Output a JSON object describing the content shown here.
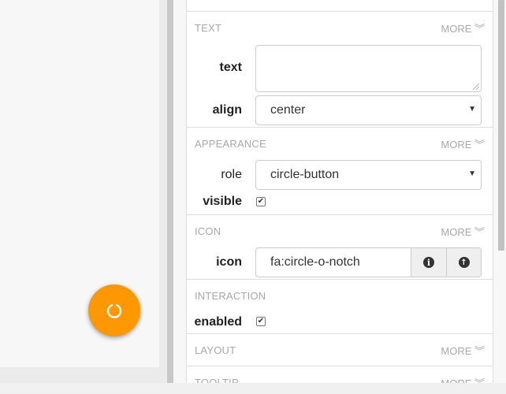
{
  "sections": {
    "text": {
      "title": "TEXT",
      "more": "MORE ︾",
      "text_label": "text",
      "text_value": "",
      "align_label": "align",
      "align_value": "center"
    },
    "appearance": {
      "title": "APPEARANCE",
      "more": "MORE ︾",
      "role_label": "role",
      "role_value": "circle-button",
      "visible_label": "visible",
      "visible_checked": true
    },
    "icon": {
      "title": "ICON",
      "more": "MORE ︾",
      "icon_label": "icon",
      "icon_value": "fa:circle-o-notch",
      "info_glyph": "i",
      "upload_glyph": "↑"
    },
    "interaction": {
      "title": "INTERACTION",
      "enabled_label": "enabled",
      "enabled_checked": true
    },
    "layout": {
      "title": "LAYOUT",
      "more": "MORE ︾"
    },
    "tooltip": {
      "title": "TOOLTIP",
      "more": "MORE ︾"
    }
  },
  "checkmark": "✔",
  "colors": {
    "accent": "#ff9800",
    "section_title": "#a8a8a8"
  },
  "icons": {
    "fab": "circle-o-notch-icon",
    "info": "info-circle-icon",
    "upload": "arrow-circle-up-icon"
  }
}
